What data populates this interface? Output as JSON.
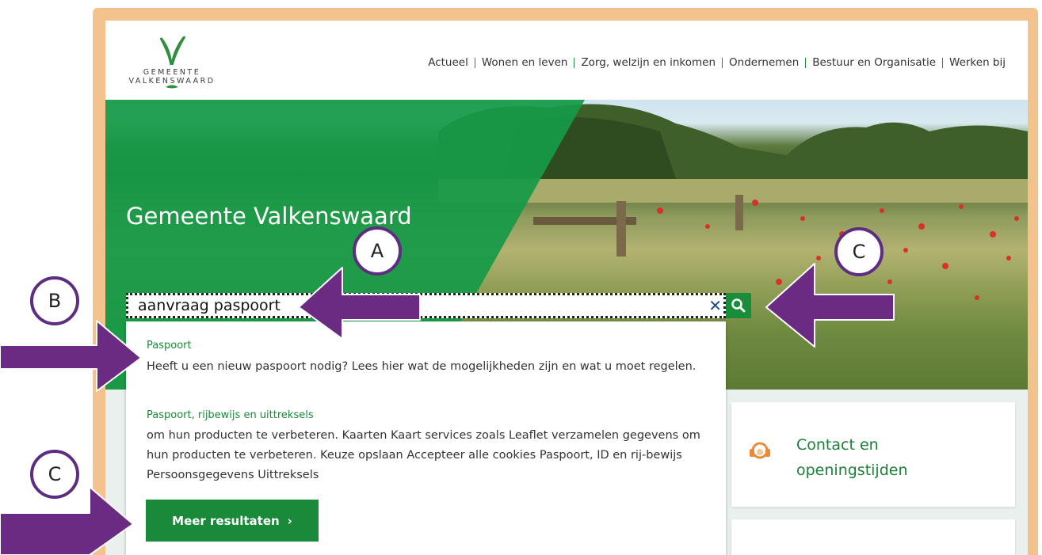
{
  "logo": {
    "line1": "GEMEENTE",
    "line2": "VALKENSWAARD"
  },
  "nav": [
    {
      "label": "Actueel"
    },
    {
      "label": "Wonen en leven"
    },
    {
      "label": "Zorg, welzijn en inkomen"
    },
    {
      "label": "Ondernemen"
    },
    {
      "label": "Bestuur en Organisatie"
    },
    {
      "label": "Werken bij"
    }
  ],
  "hero": {
    "title": "Gemeente Valkenswaard"
  },
  "search": {
    "value": "aanvraag paspoort",
    "clear_icon": "close-icon",
    "button_icon": "search-icon"
  },
  "results": [
    {
      "title": "Paspoort",
      "text": "Heeft u een nieuw paspoort nodig? Lees hier wat de mogelijkheden zijn en wat u moet regelen."
    },
    {
      "title": "Paspoort, rijbewijs en uittreksels",
      "text": "om hun producten te verbeteren. Kaarten Kaart services zoals Leaflet verzamelen gegevens om hun producten te verbeteren. Keuze opslaan Accepteer alle cookies Paspoort, ID en rij-bewijs Persoonsgegevens Uittreksels"
    }
  ],
  "more_button": {
    "label": "Meer resultaten",
    "chevron": "›"
  },
  "card": {
    "label": "Contact en openingstijden",
    "icon": "headset-icon"
  },
  "annotations": {
    "a": "A",
    "b": "B",
    "c1": "C",
    "c2": "C"
  },
  "colors": {
    "brand_green": "#1a8d3b",
    "frame": "#f4c38d",
    "arrow_purple": "#6b2b82"
  }
}
